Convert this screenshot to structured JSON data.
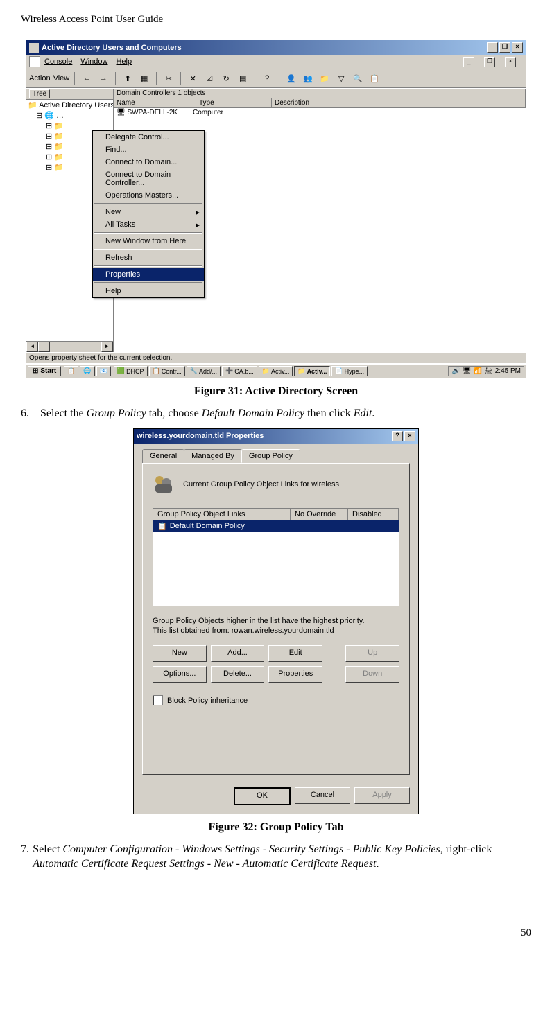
{
  "page": {
    "header": "Wireless Access Point User Guide",
    "page_number": "50"
  },
  "fig31": {
    "caption": "Figure 31: Active Directory Screen",
    "titlebar": "Active Directory Users and Computers",
    "menu": {
      "console": "Console",
      "window": "Window",
      "help": "Help"
    },
    "toolbar": {
      "action": "Action",
      "view": "View"
    },
    "tree_tab": "Tree",
    "tree_root": "Active Directory Users",
    "list_header_prefix": "Domain Controllers    1 objects",
    "columns": {
      "name": "Name",
      "type": "Type",
      "description": "Description"
    },
    "row": {
      "name": "SWPA-DELL-2K",
      "type": "Computer"
    },
    "context": {
      "delegate": "Delegate Control...",
      "find": "Find...",
      "connect_domain": "Connect to Domain...",
      "connect_dc": "Connect to Domain Controller...",
      "op_masters": "Operations Masters...",
      "new": "New",
      "all_tasks": "All Tasks",
      "new_window": "New Window from Here",
      "refresh": "Refresh",
      "properties": "Properties",
      "help": "Help"
    },
    "status": "Opens property sheet for the current selection.",
    "start": "Start",
    "task": {
      "dhcp": "DHCP",
      "contr": "Contr...",
      "add": "Add/...",
      "ca": "CA.b...",
      "activ1": "Activ...",
      "activ2": "Activ...",
      "hype": "Hype..."
    },
    "clock": "2:45 PM"
  },
  "step6": {
    "num": "6.",
    "text_before": "Select the ",
    "gp": "Group Policy",
    "text_mid": " tab, choose ",
    "ddp": "Default Domain Policy",
    "text_mid2": " then click ",
    "edit": "Edit",
    "period": "."
  },
  "fig32": {
    "caption": "Figure 32: Group Policy Tab",
    "title": "wireless.yourdomain.tld Properties",
    "tabs": {
      "general": "General",
      "managed": "Managed By",
      "gp": "Group Policy"
    },
    "heading": "Current Group Policy Object Links for wireless",
    "cols": {
      "links": "Group Policy Object Links",
      "noover": "No Override",
      "disabled": "Disabled"
    },
    "row": "Default Domain Policy",
    "note1": "Group Policy Objects higher in the list have the highest priority.",
    "note2": "This list obtained from: rowan.wireless.yourdomain.tld",
    "btns": {
      "new": "New",
      "add": "Add...",
      "edit": "Edit",
      "up": "Up",
      "options": "Options...",
      "delete": "Delete...",
      "properties": "Properties",
      "down": "Down"
    },
    "block": "Block Policy inheritance",
    "ok": "OK",
    "cancel": "Cancel",
    "apply": "Apply"
  },
  "step7": {
    "num": "7.",
    "t1": "Select ",
    "path1": "Computer Configuration - Windows Settings - Security Settings - Public Key Policies",
    "t2": ", right-click ",
    "path2": "Automatic Certificate Request Settings -  New - Automatic Certificate Request",
    "period": "."
  }
}
